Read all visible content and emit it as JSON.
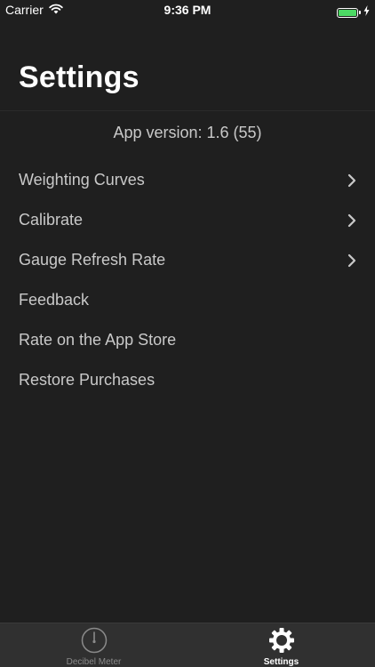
{
  "status_bar": {
    "carrier": "Carrier",
    "time": "9:36 PM",
    "battery_color": "#4cd964"
  },
  "header": {
    "title": "Settings"
  },
  "app_version": "App version: 1.6 (55)",
  "menu": {
    "items": [
      {
        "label": "Weighting Curves",
        "has_chevron": true
      },
      {
        "label": "Calibrate",
        "has_chevron": true
      },
      {
        "label": "Gauge Refresh Rate",
        "has_chevron": true
      },
      {
        "label": "Feedback",
        "has_chevron": false
      },
      {
        "label": "Rate on the App Store",
        "has_chevron": false
      },
      {
        "label": "Restore Purchases",
        "has_chevron": false
      }
    ]
  },
  "tab_bar": {
    "tabs": [
      {
        "label": "Decibel Meter",
        "icon": "gauge-icon",
        "active": false
      },
      {
        "label": "Settings",
        "icon": "gear-icon",
        "active": true
      }
    ]
  }
}
